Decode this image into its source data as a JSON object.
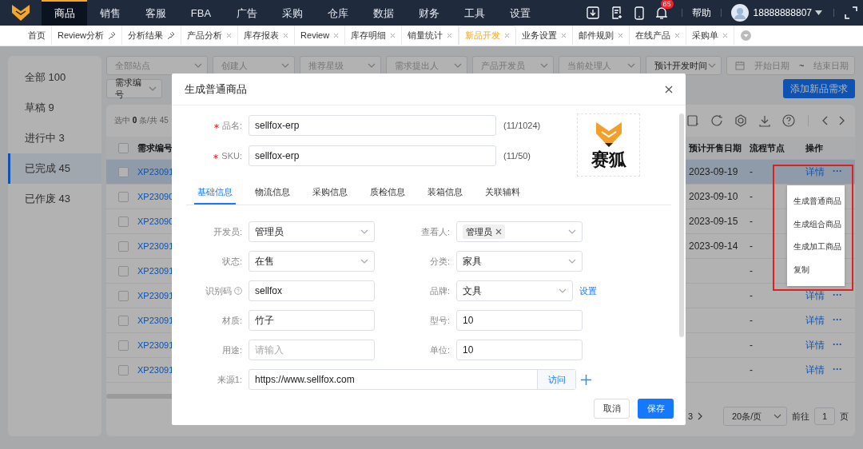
{
  "top_nav": {
    "items": [
      {
        "label": "商品",
        "selected": true
      },
      {
        "label": "销售",
        "selected": false
      },
      {
        "label": "客服",
        "selected": false
      },
      {
        "label": "FBA",
        "selected": false
      },
      {
        "label": "广告",
        "selected": false
      },
      {
        "label": "采购",
        "selected": false
      },
      {
        "label": "仓库",
        "selected": false
      },
      {
        "label": "数据",
        "selected": false
      },
      {
        "label": "财务",
        "selected": false
      },
      {
        "label": "工具",
        "selected": false
      },
      {
        "label": "设置",
        "selected": false
      }
    ],
    "notification_badge": "65",
    "help": "帮助",
    "user": "18888888807"
  },
  "page_tabs": [
    {
      "label": "首页",
      "kind": "home",
      "selected": false
    },
    {
      "label": "Review分析",
      "kind": "pinned",
      "selected": false
    },
    {
      "label": "分析结果",
      "kind": "pinned",
      "selected": false
    },
    {
      "label": "产品分析",
      "kind": "closable",
      "selected": false
    },
    {
      "label": "库存报表",
      "kind": "closable",
      "selected": false
    },
    {
      "label": "Review",
      "kind": "closable",
      "selected": false
    },
    {
      "label": "库存明细",
      "kind": "closable",
      "selected": false
    },
    {
      "label": "销量统计",
      "kind": "closable",
      "selected": false
    },
    {
      "label": "新品开发",
      "kind": "closable",
      "selected": true
    },
    {
      "label": "业务设置",
      "kind": "closable",
      "selected": false
    },
    {
      "label": "邮件规则",
      "kind": "closable",
      "selected": false
    },
    {
      "label": "在线产品",
      "kind": "closable",
      "selected": false
    },
    {
      "label": "采购单",
      "kind": "closable",
      "selected": false
    }
  ],
  "sidebar": {
    "items": [
      {
        "label": "全部",
        "count": "100",
        "selected": false
      },
      {
        "label": "草稿",
        "count": "9",
        "selected": false
      },
      {
        "label": "进行中",
        "count": "3",
        "selected": false
      },
      {
        "label": "已完成",
        "count": "45",
        "selected": true
      },
      {
        "label": "已作废",
        "count": "43",
        "selected": false
      }
    ]
  },
  "filters": {
    "row_1": [
      {
        "placeholder": "全部站点"
      },
      {
        "placeholder": "创建人"
      },
      {
        "placeholder": "推荐星级"
      },
      {
        "placeholder": "需求提出人"
      },
      {
        "placeholder": "产品开发员"
      },
      {
        "placeholder": "当前处理人"
      },
      {
        "value": "预计开发时间"
      }
    ],
    "date_range": {
      "start_placeholder": "开始日期",
      "separator": "~",
      "end_placeholder": "结束日期"
    },
    "row_2": [
      {
        "value": "需求编号"
      }
    ],
    "add_button": "添加新品需求"
  },
  "table": {
    "selection_summary": "选中 **0** 条/共 45",
    "header_checked": false,
    "columns": [
      "需求编号",
      "预计开售日期",
      "流程节点",
      "操作"
    ],
    "rows": [
      {
        "id": "XP23091",
        "sale_date": "2023-09-19",
        "stage": "-",
        "detail": "详情",
        "more": "···",
        "checked": false,
        "selected": true
      },
      {
        "id": "XP23090",
        "sale_date": "2023-09-10",
        "stage": "-",
        "checked": false,
        "selected": false
      },
      {
        "id": "XP23090",
        "sale_date": "2023-09-15",
        "stage": "-",
        "checked": false,
        "selected": false
      },
      {
        "id": "XP23091",
        "sale_date": "2023-09-14",
        "stage": "-",
        "checked": false,
        "selected": false
      },
      {
        "id": "XP23091",
        "stage": "-",
        "checked": false,
        "selected": false
      },
      {
        "id": "XP23091",
        "stage": "-",
        "detail": "详情",
        "more": "···",
        "checked": false,
        "selected": false
      },
      {
        "id": "XP23091",
        "stage": "-",
        "detail": "详情",
        "more": "···",
        "checked": false,
        "selected": false
      },
      {
        "id": "XP23091",
        "stage": "-",
        "detail": "详情",
        "more": "···",
        "checked": false,
        "selected": false
      },
      {
        "id": "XP23091",
        "stage": "-",
        "detail": "详情",
        "more": "···",
        "checked": false,
        "selected": false
      }
    ]
  },
  "pagination": {
    "page": "3",
    "page_size": "20条/页",
    "goto_label": "前往",
    "goto_value": "1",
    "page_unit": "页"
  },
  "dialog": {
    "title": "生成普通商品",
    "header_fields": [
      {
        "label": "品名:",
        "required": true,
        "value": "sellfox-erp",
        "counter": "(11/1024)"
      },
      {
        "label": "SKU:",
        "required": true,
        "value": "sellfox-erp",
        "counter": "(11/50)"
      }
    ],
    "image_caption": "赛狐",
    "tabs": [
      {
        "label": "基础信息",
        "selected": true
      },
      {
        "label": "物流信息",
        "selected": false
      },
      {
        "label": "采购信息",
        "selected": false
      },
      {
        "label": "质检信息",
        "selected": false
      },
      {
        "label": "装箱信息",
        "selected": false
      },
      {
        "label": "关联辅料",
        "selected": false
      }
    ],
    "fields": [
      {
        "label": "开发员:",
        "kind": "select",
        "value": "管理员"
      },
      {
        "label": "查看人:",
        "kind": "tags",
        "tags": [
          "管理员"
        ]
      },
      {
        "label": "状态:",
        "kind": "select",
        "value": "在售"
      },
      {
        "label": "分类:",
        "kind": "select",
        "value": "家具"
      },
      {
        "label": "识别码",
        "kind": "input",
        "value": "sellfox",
        "help": true
      },
      {
        "label": "品牌:",
        "kind": "select",
        "value": "文具",
        "link": "设置"
      },
      {
        "label": "材质:",
        "kind": "input",
        "value": "竹子"
      },
      {
        "label": "型号:",
        "kind": "input",
        "value": "10"
      },
      {
        "label": "用途:",
        "kind": "input",
        "placeholder": "请输入"
      },
      {
        "label": "单位:",
        "kind": "input",
        "value": "10"
      },
      {
        "label": "来源1:",
        "kind": "url",
        "value": "https://www.sellfox.com",
        "button": "访问"
      }
    ],
    "buttons": [
      {
        "label": "取消",
        "kind": "default"
      },
      {
        "label": "保存",
        "kind": "primary"
      }
    ]
  },
  "context_menu": {
    "items": [
      "生成普通商品",
      "生成组合商品",
      "生成加工商品",
      "复制"
    ]
  }
}
